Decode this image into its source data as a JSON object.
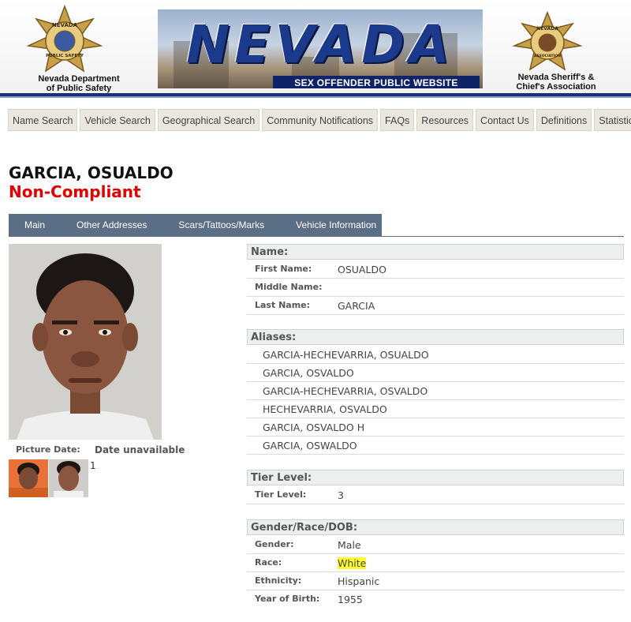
{
  "header": {
    "left_badge_text": [
      "NEVADA",
      "DEPARTMENT OF",
      "PUBLIC SAFETY"
    ],
    "left_caption_line1": "Nevada Department",
    "left_caption_line2": "of Public Safety",
    "title": "NEVADA",
    "subtitle": "SEX OFFENDER PUBLIC WEBSITE",
    "right_badge_text": [
      "NEVADA",
      "SHERIFFS AND CHIEFS",
      "ASSOCIATION"
    ],
    "right_caption_line1": "Nevada Sheriff's &",
    "right_caption_line2": "Chief's Association"
  },
  "nav": {
    "items": [
      "Name Search",
      "Vehicle Search",
      "Geographical Search",
      "Community Notifications",
      "FAQs",
      "Resources",
      "Contact Us",
      "Definitions",
      "Statistics"
    ]
  },
  "offender": {
    "name": "GARCIA, OSUALDO",
    "status": "Non-Compliant"
  },
  "tabs": [
    "Main",
    "Other Addresses",
    "Scars/Tattoos/Marks",
    "Vehicle Information"
  ],
  "photo": {
    "date_label": "Picture Date:",
    "date_value": "Date unavailable",
    "thumb_count": "1"
  },
  "sections": {
    "name": {
      "heading": "Name:",
      "first_label": "First Name:",
      "first_value": "OSUALDO",
      "middle_label": "Middle Name:",
      "middle_value": "",
      "last_label": "Last Name:",
      "last_value": "GARCIA"
    },
    "aliases": {
      "heading": "Aliases:",
      "items": [
        "GARCIA-HECHEVARRIA, OSUALDO",
        "GARCIA, OSVALDO",
        "GARCIA-HECHEVARRIA, OSVALDO",
        "HECHEVARRIA, OSVALDO",
        "GARCIA, OSVALDO H",
        "GARCIA, OSWALDO"
      ]
    },
    "tier": {
      "heading": "Tier Level:",
      "label": "Tier Level:",
      "value": "3"
    },
    "demographics": {
      "heading": "Gender/Race/DOB:",
      "gender_label": "Gender:",
      "gender_value": "Male",
      "race_label": "Race:",
      "race_value": "White",
      "ethnicity_label": "Ethnicity:",
      "ethnicity_value": "Hispanic",
      "yob_label": "Year of Birth:",
      "yob_value": "1955"
    }
  },
  "colors": {
    "tab_bar": "#5a6e85",
    "status_red": "#e00000",
    "banner_rule": "#1a2f72",
    "highlight": "#ffff33"
  }
}
